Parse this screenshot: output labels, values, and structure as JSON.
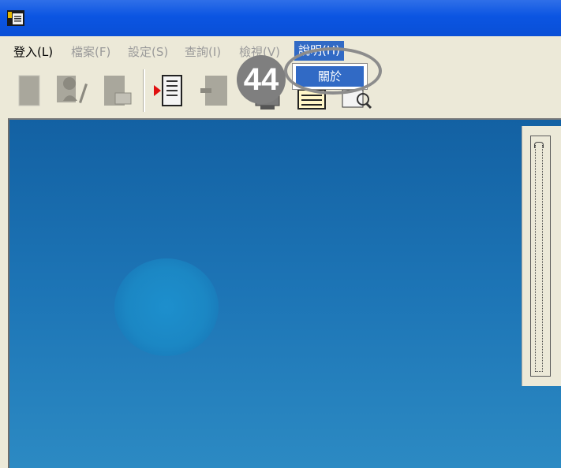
{
  "window": {
    "title": ""
  },
  "menu": {
    "items": [
      {
        "label": "登入(L)",
        "enabled": true
      },
      {
        "label": "檔案(F)",
        "enabled": false
      },
      {
        "label": "設定(S)",
        "enabled": false
      },
      {
        "label": "查詢(I)",
        "enabled": false
      },
      {
        "label": "檢視(V)",
        "enabled": false
      },
      {
        "label": "說明(H)",
        "enabled": true,
        "active": true
      }
    ]
  },
  "toolbar": {
    "buttons": [
      {
        "icon": "document-icon",
        "enabled": false
      },
      {
        "icon": "user-edit-icon",
        "enabled": false
      },
      {
        "icon": "document-print-icon",
        "enabled": false
      },
      {
        "icon": "document-arrow-icon",
        "enabled": true
      },
      {
        "icon": "document-back-icon",
        "enabled": false
      },
      {
        "icon": "monitor-icon",
        "enabled": true
      },
      {
        "icon": "list-icon",
        "enabled": true
      },
      {
        "icon": "search-document-icon",
        "enabled": true
      }
    ]
  },
  "help_menu": {
    "items": [
      {
        "label": "關於"
      }
    ]
  },
  "annotation": {
    "step": "44"
  },
  "colors": {
    "titlebar": "#0b55e2",
    "menu_highlight": "#316ac5",
    "workspace": "#1d75b6"
  }
}
